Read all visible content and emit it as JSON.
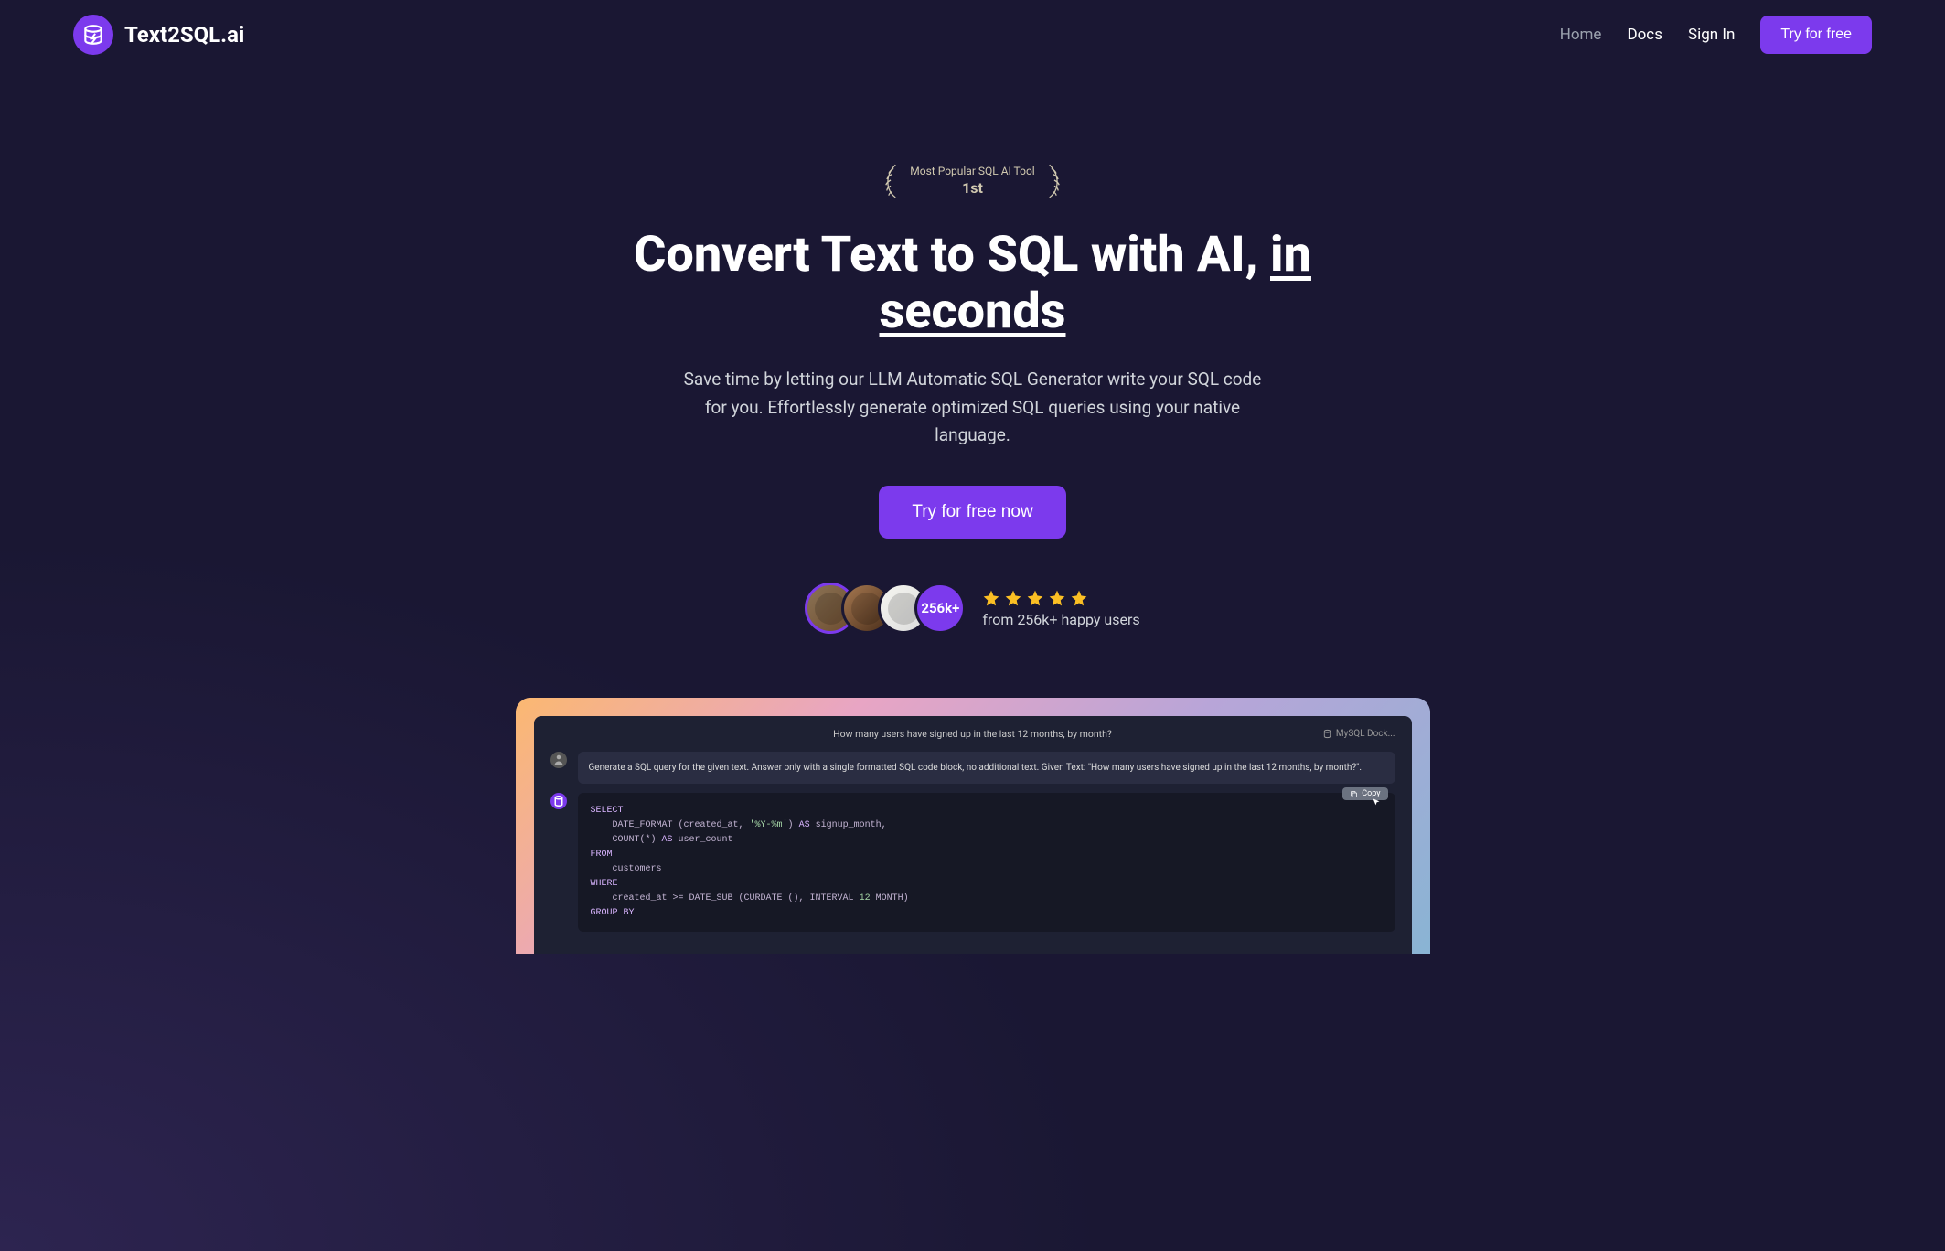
{
  "brand": "Text2SQL.ai",
  "nav": {
    "home": "Home",
    "docs": "Docs",
    "signin": "Sign In",
    "cta": "Try for free"
  },
  "badge": {
    "top": "Most Popular SQL AI Tool",
    "bottom": "1st"
  },
  "headline": {
    "part1": "Convert Text to SQL with AI, ",
    "underline": "in seconds"
  },
  "subhead": "Save time by letting our LLM Automatic SQL Generator write your SQL code for you. Effortlessly generate optimized SQL queries using your native language.",
  "cta_main": "Try for free now",
  "social": {
    "count": "256k+",
    "text": "from 256k+ happy users"
  },
  "demo": {
    "question": "How many users have signed up in the last 12 months, by month?",
    "connector": "MySQL Dock...",
    "user_msg": "Generate a SQL query for the given text. Answer only with a single formatted SQL code block, no additional text. Given Text: \"How many users have signed up in the last 12 months, by month?\".",
    "copy": "Copy",
    "code": {
      "l1a": "SELECT",
      "l2a": "    DATE_FORMAT",
      "l2b": " (created_at, ",
      "l2c": "'%Y-%m'",
      "l2d": ") ",
      "l2e": "AS",
      "l2f": " signup_month,",
      "l3a": "    COUNT",
      "l3b": "(*) ",
      "l3c": "AS",
      "l3d": " user_count",
      "l4a": "FROM",
      "l5a": "    customers",
      "l6a": "WHERE",
      "l7a": "    created_at >= DATE_SUB (CURDATE (), INTERVAL ",
      "l7b": "12",
      "l7c": " MONTH)",
      "l8a": "GROUP BY"
    }
  }
}
